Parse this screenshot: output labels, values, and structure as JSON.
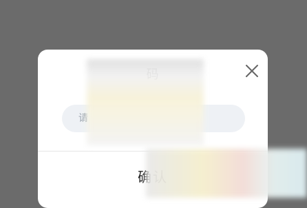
{
  "dialog": {
    "title": "码",
    "input_placeholder": "请",
    "input_value": "",
    "confirm_label": "确认"
  },
  "icons": {
    "close": "close-icon"
  },
  "colors": {
    "backdrop": "#6b6b6b",
    "dialog_bg": "#ffffff",
    "input_bg": "#eef1f5",
    "text": "#222222"
  }
}
